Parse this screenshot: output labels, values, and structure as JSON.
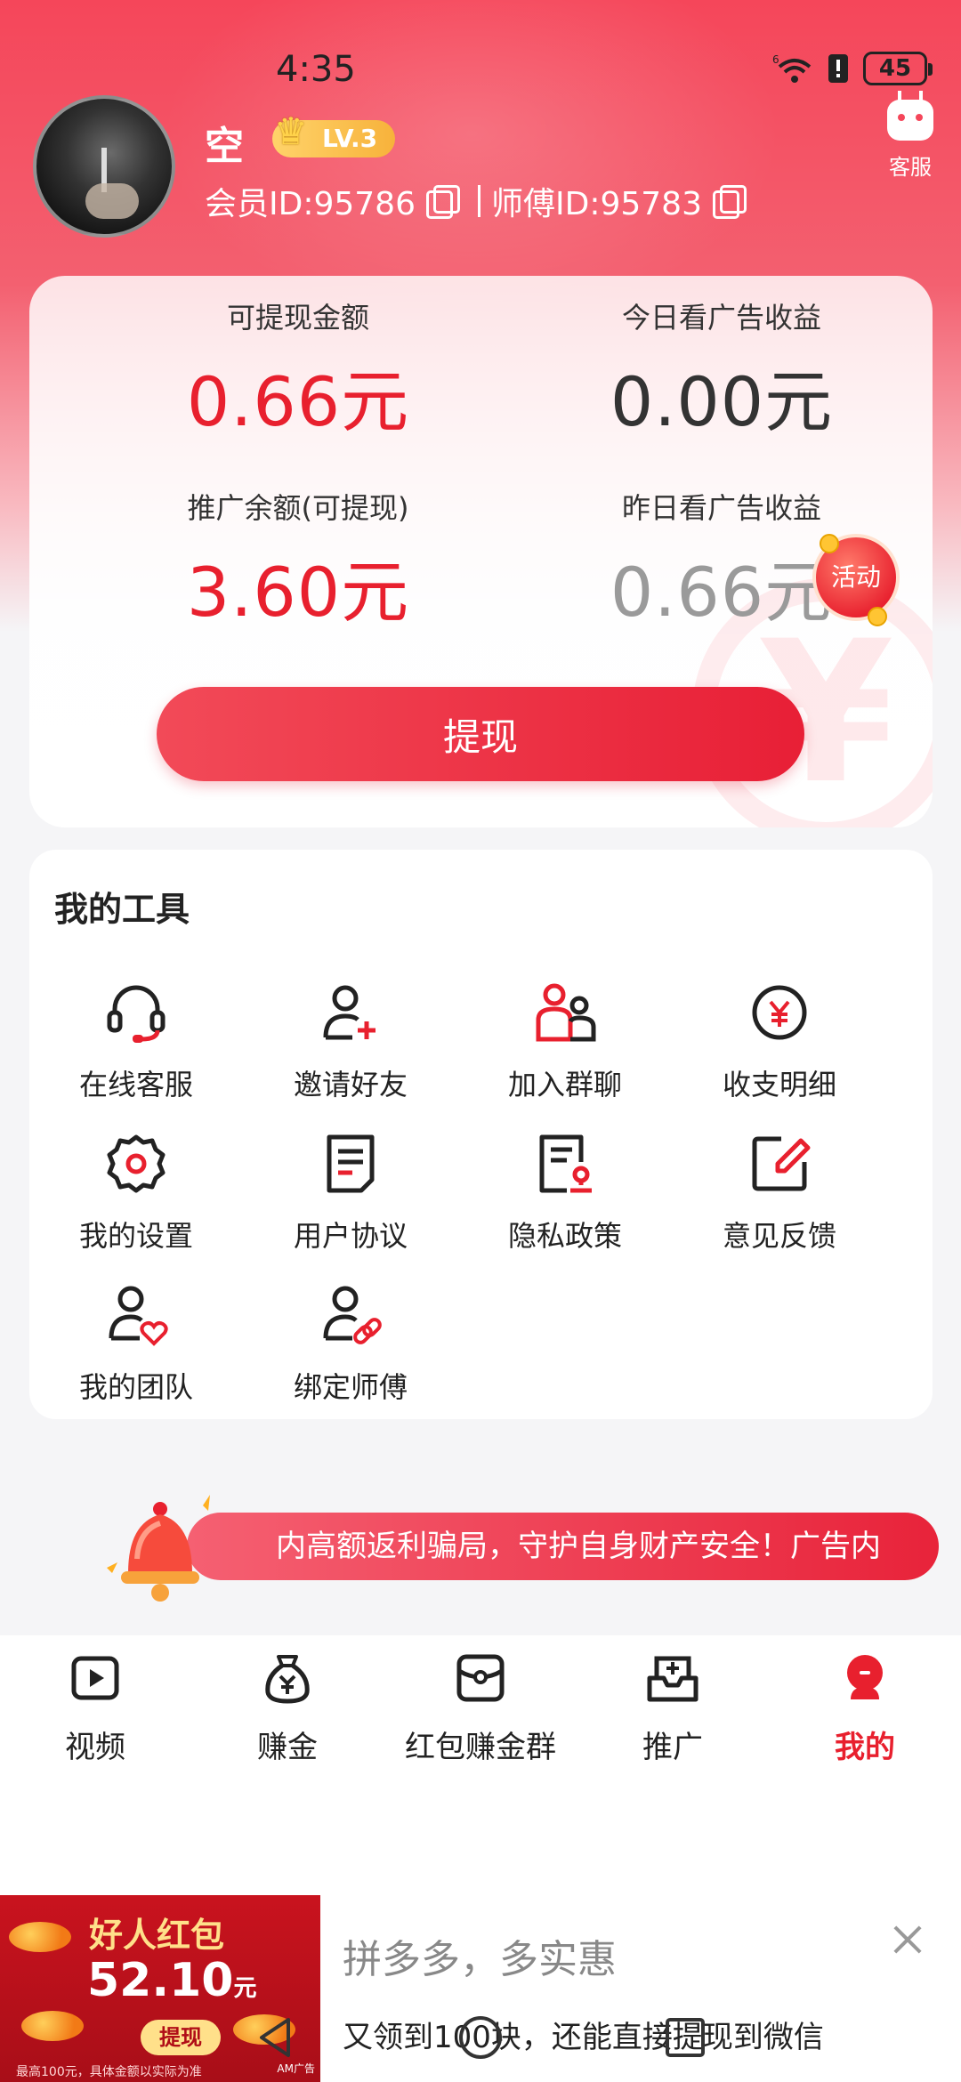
{
  "status_bar": {
    "time": "4:35",
    "battery": "45",
    "signal_label": "6"
  },
  "profile": {
    "name": "空",
    "level": "LV.3",
    "member_id": "会员ID:95786",
    "master_id": "师傅ID:95783",
    "service_label": "客服"
  },
  "wallet": {
    "withdrawable_label": "可提现金额",
    "withdrawable_value": "0.66元",
    "today_ad_label": "今日看广告收益",
    "today_ad_value": "0.00元",
    "promo_balance_label": "推广余额(可提现)",
    "promo_balance_value": "3.60元",
    "yesterday_ad_label": "昨日看广告收益",
    "yesterday_ad_value": "0.66元",
    "activity_badge": "活动",
    "withdraw_button": "提现"
  },
  "tools": {
    "title": "我的工具",
    "items": [
      {
        "label": "在线客服",
        "icon": "headset-icon"
      },
      {
        "label": "邀请好友",
        "icon": "add-user-icon"
      },
      {
        "label": "加入群聊",
        "icon": "group-icon"
      },
      {
        "label": "收支明细",
        "icon": "yuan-icon"
      },
      {
        "label": "我的设置",
        "icon": "gear-icon"
      },
      {
        "label": "用户协议",
        "icon": "document-icon"
      },
      {
        "label": "隐私政策",
        "icon": "privacy-doc-icon"
      },
      {
        "label": "意见反馈",
        "icon": "edit-icon"
      },
      {
        "label": "我的团队",
        "icon": "team-heart-icon"
      },
      {
        "label": "绑定师傅",
        "icon": "link-user-icon"
      }
    ]
  },
  "notice": {
    "text": "内高额返利骗局，守护自身财产安全！广告内"
  },
  "bottom_nav": [
    {
      "label": "视频",
      "icon": "play-icon",
      "active": false
    },
    {
      "label": "赚金",
      "icon": "money-bag-icon",
      "active": false
    },
    {
      "label": "红包赚金群",
      "icon": "red-packet-icon",
      "active": false
    },
    {
      "label": "推广",
      "icon": "promote-icon",
      "active": false
    },
    {
      "label": "我的",
      "icon": "profile-icon",
      "active": true
    }
  ],
  "ad": {
    "image_title": "好人红包",
    "image_amount": "52.10",
    "image_unit": "元",
    "image_button": "提现",
    "image_fine_print": "最高100元，具体金额以实际为准",
    "image_tag": "AM广告",
    "title": "拼多多，多实惠",
    "description": "又领到100块，还能直接提现到微信"
  },
  "colors": {
    "accent": "#e8202e",
    "header": "#f5465a",
    "text": "#222222",
    "muted": "#9a9a9a"
  }
}
